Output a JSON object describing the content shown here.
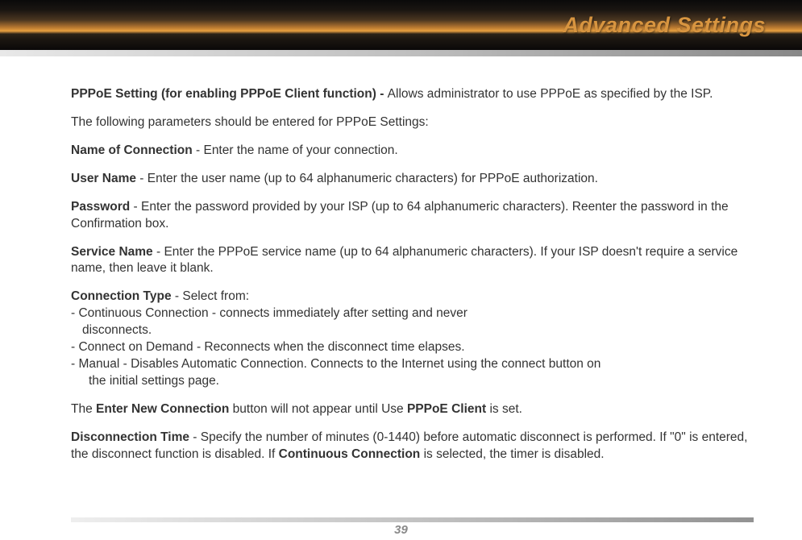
{
  "header": {
    "title": "Advanced Settings"
  },
  "content": {
    "pppoe_setting_label": "PPPoE Setting (for enabling PPPoE Client function) - ",
    "pppoe_setting_text": "Allows administrator to use PPPoE as specified by the ISP.",
    "params_intro": "The following parameters should be entered for PPPoE Settings:",
    "name_conn_label": "Name of Connection",
    "name_conn_text": " - Enter the name of your connection.",
    "user_name_label": "User Name",
    "user_name_text": " - Enter the user name (up to 64 alphanumeric characters) for PPPoE authorization.",
    "password_label": "Password",
    "password_text": " - Enter the password provided by your ISP (up to 64 alphanumeric characters).  Reenter the password in the Confirmation box.",
    "service_name_label": "Service Name",
    "service_name_text": " - Enter the PPPoE service name (up to 64 alphanumeric characters).  If your ISP doesn't require a service name, then leave it blank.",
    "conn_type_label": "Connection Type",
    "conn_type_text": " - Select from:",
    "conn_type_opt1_line1": "- Continuous Connection - connects immediately after setting and never",
    "conn_type_opt1_line2": "disconnects.",
    "conn_type_opt2": "- Connect on Demand - Reconnects when the disconnect time elapses.",
    "conn_type_opt3_line1": "- Manual - Disables Automatic Connection.  Connects to the Internet using  the connect button on",
    "conn_type_opt3_line2": "the initial settings page.",
    "enter_new_pre": "The ",
    "enter_new_bold1": "Enter New Connection",
    "enter_new_mid": " button will not appear until Use ",
    "enter_new_bold2": "PPPoE Client",
    "enter_new_post": " is set.",
    "disc_time_label": "Disconnection Time",
    "disc_time_text1": " - Specify the number of minutes (0-1440) before automatic disconnect is performed.  If \"0\" is entered, the disconnect function is disabled.  If ",
    "disc_time_bold": "Continuous Connection",
    "disc_time_text2": " is selected, the timer is disabled."
  },
  "footer": {
    "page_number": "39"
  }
}
